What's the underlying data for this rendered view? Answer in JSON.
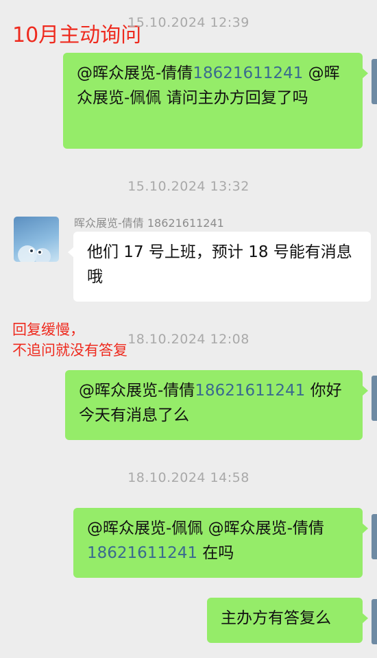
{
  "notes": {
    "top": "10月主动询问",
    "mid_line1": "回复缓慢，",
    "mid_line2": "不追问就没有答复"
  },
  "timestamps": [
    "15.10.2024 12:39",
    "15.10.2024 13:32",
    "18.10.2024 12:08",
    "18.10.2024 14:58"
  ],
  "messages": {
    "m1": {
      "mention1": "@晖众展览-倩倩",
      "phone": "18621611241",
      "rest": " @晖众展览-佩佩 请问主办方回复了吗"
    },
    "m2": {
      "sender": "晖众展览-倩倩 18621611241",
      "text": "他们 17 号上班，预计 18 号能有消息哦"
    },
    "m3": {
      "mention": "@晖众展览-倩倩",
      "phone": "18621611241",
      "rest": " 你好 今天有消息了么"
    },
    "m4": {
      "lead": "@晖众展览-佩佩 @晖众展览-倩倩",
      "phone": "18621611241",
      "rest": " 在吗"
    },
    "m5": {
      "text": "主办方有答复么"
    }
  },
  "colors": {
    "outgoing_bubble": "#95ec69",
    "incoming_bubble": "#ffffff",
    "annotation_red": "#ee2a1e",
    "mention_blue": "#3a6a8f",
    "background": "#ededed"
  }
}
